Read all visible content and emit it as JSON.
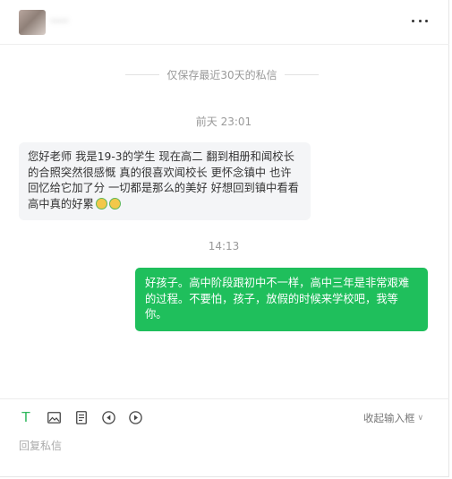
{
  "header": {
    "username": "·····",
    "more_icon": "more-horizontal-icon"
  },
  "notice": {
    "text": "仅保存最近30天的私信"
  },
  "messages": [
    {
      "time": "前天 23:01",
      "direction": "incoming",
      "text": "您好老师 我是19-3的学生 现在高二 翻到相册和闻校长的合照突然很感慨 真的很喜欢闻校长 更怀念镇中 也许回忆给它加了分 一切都是那么的美好 好想回到镇中看看 高中真的好累",
      "emoji": [
        "crying-emoji",
        "crying-emoji"
      ]
    },
    {
      "time": "14:13",
      "direction": "outgoing",
      "text": "好孩子。高中阶段跟初中不一样，高中三年是非常艰难的过程。不要怕，孩子，放假的时候来学校吧，我等你。"
    }
  ],
  "input": {
    "tools": {
      "text_label": "T",
      "text": "text-format-icon",
      "image": "image-icon",
      "doc": "document-icon",
      "prev": "rewind-icon",
      "play": "play-icon"
    },
    "collapse_label": "收起输入框",
    "placeholder": "回复私信"
  },
  "colors": {
    "outgoing_bubble": "#1fbf5c",
    "incoming_bubble": "#f4f5f7",
    "accent": "#2eb85c"
  }
}
